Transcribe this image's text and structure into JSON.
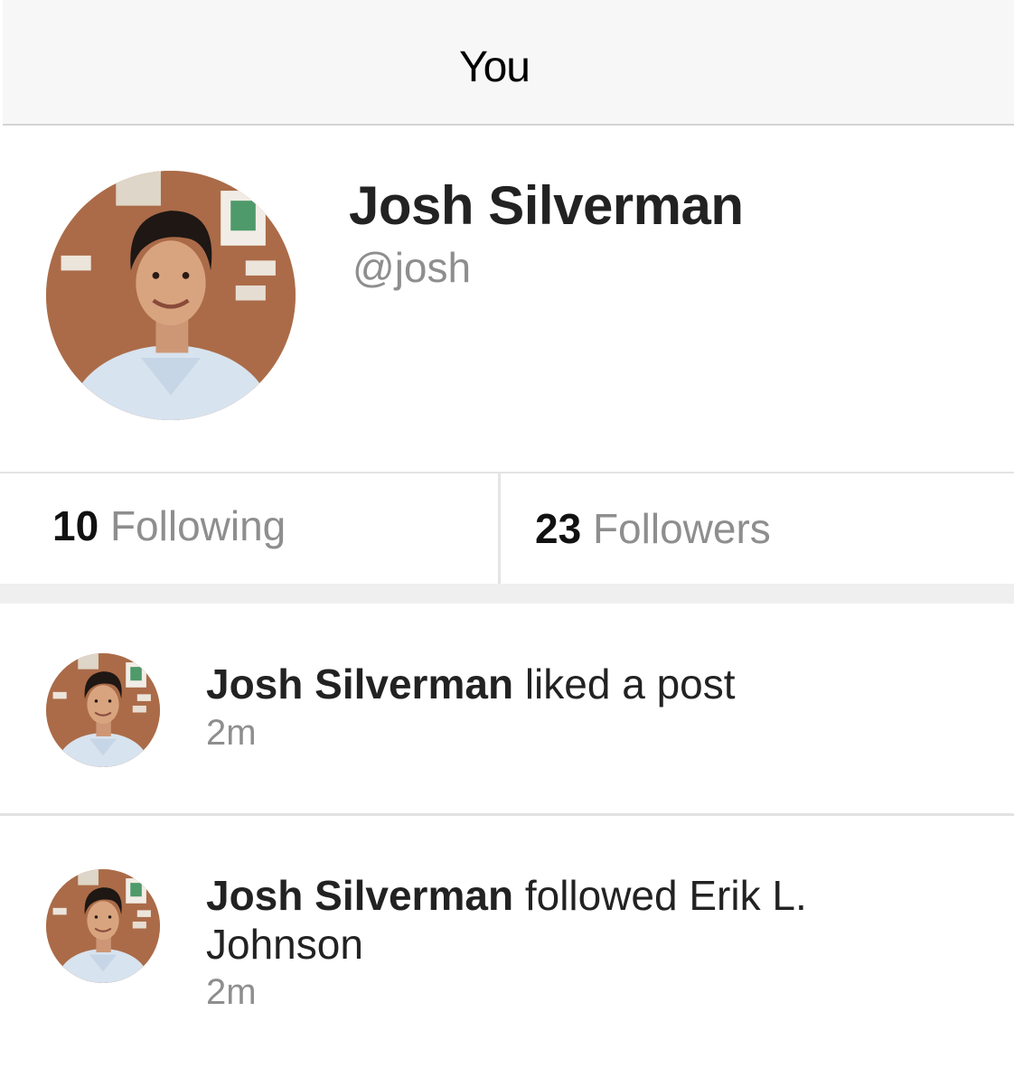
{
  "nav": {
    "title": "You"
  },
  "profile": {
    "name": "Josh Silverman",
    "handle": "@josh",
    "avatar_icon": "user-photo"
  },
  "stats": {
    "following": {
      "count": "10",
      "label": "Following"
    },
    "followers": {
      "count": "23",
      "label": "Followers"
    }
  },
  "activity": [
    {
      "actor": "Josh Silverman",
      "action": "liked a post",
      "time": "2m",
      "avatar_icon": "user-photo"
    },
    {
      "actor": "Josh Silverman",
      "action": "followed Erik L. Johnson",
      "time": "2m",
      "avatar_icon": "user-photo"
    }
  ],
  "colors": {
    "nav_background": "#f7f7f7",
    "primary_text": "#222222",
    "secondary_text": "#8e8e8e",
    "divider": "#e4e4e4"
  }
}
